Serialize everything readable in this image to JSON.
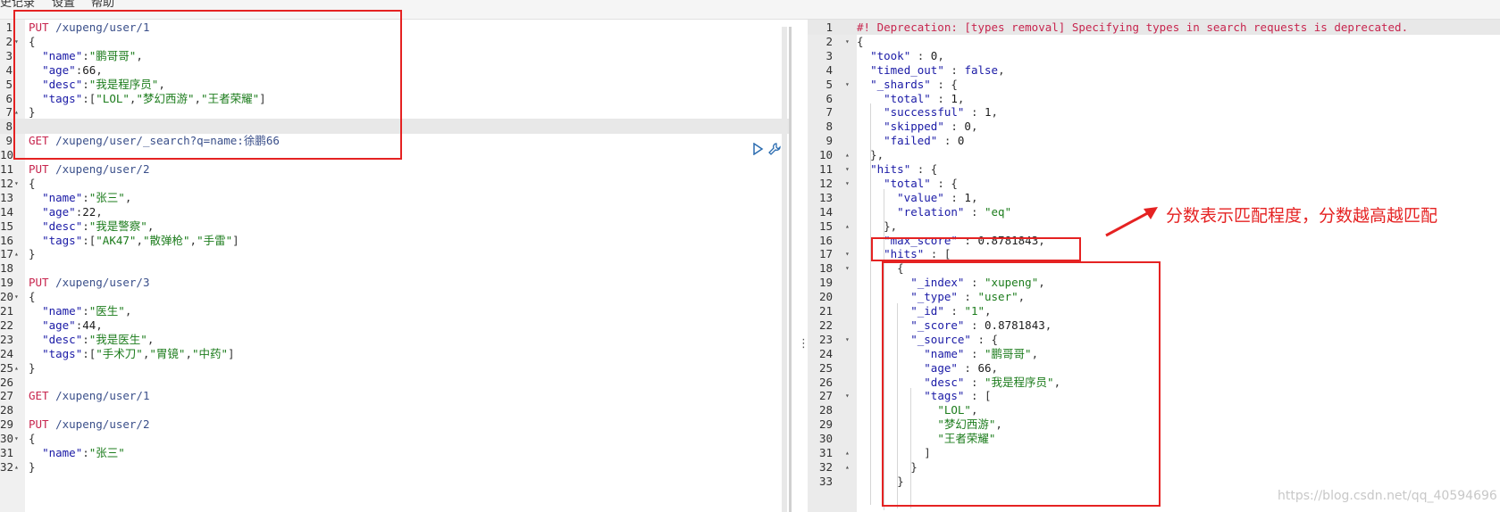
{
  "menu": {
    "history": "史记录",
    "settings": "设置",
    "help": "帮助"
  },
  "request_editor": {
    "lines": [
      [
        {
          "c": "tok-method",
          "t": "PUT "
        },
        {
          "c": "tok-url",
          "t": "/xupeng/user/1"
        }
      ],
      [
        {
          "c": "tok-punc",
          "t": "{"
        }
      ],
      [
        {
          "c": "tok-punc",
          "t": "  "
        },
        {
          "c": "tok-key",
          "t": "\"name\""
        },
        {
          "c": "tok-punc",
          "t": ":"
        },
        {
          "c": "tok-str",
          "t": "\"鹏哥哥\""
        },
        {
          "c": "tok-punc",
          "t": ","
        }
      ],
      [
        {
          "c": "tok-punc",
          "t": "  "
        },
        {
          "c": "tok-key",
          "t": "\"age\""
        },
        {
          "c": "tok-punc",
          "t": ":"
        },
        {
          "c": "tok-num",
          "t": "66"
        },
        {
          "c": "tok-punc",
          "t": ","
        }
      ],
      [
        {
          "c": "tok-punc",
          "t": "  "
        },
        {
          "c": "tok-key",
          "t": "\"desc\""
        },
        {
          "c": "tok-punc",
          "t": ":"
        },
        {
          "c": "tok-str",
          "t": "\"我是程序员\""
        },
        {
          "c": "tok-punc",
          "t": ","
        }
      ],
      [
        {
          "c": "tok-punc",
          "t": "  "
        },
        {
          "c": "tok-key",
          "t": "\"tags\""
        },
        {
          "c": "tok-punc",
          "t": ":["
        },
        {
          "c": "tok-str",
          "t": "\"LOL\""
        },
        {
          "c": "tok-punc",
          "t": ","
        },
        {
          "c": "tok-str",
          "t": "\"梦幻西游\""
        },
        {
          "c": "tok-punc",
          "t": ","
        },
        {
          "c": "tok-str",
          "t": "\"王者荣耀\""
        },
        {
          "c": "tok-punc",
          "t": "]"
        }
      ],
      [
        {
          "c": "tok-punc",
          "t": "}"
        }
      ],
      [],
      [
        {
          "c": "tok-method",
          "t": "GET "
        },
        {
          "c": "tok-url",
          "t": "/xupeng/user/_search?q=name:徐鹏66"
        }
      ],
      [],
      [
        {
          "c": "tok-method",
          "t": "PUT "
        },
        {
          "c": "tok-url",
          "t": "/xupeng/user/2"
        }
      ],
      [
        {
          "c": "tok-punc",
          "t": "{"
        }
      ],
      [
        {
          "c": "tok-punc",
          "t": "  "
        },
        {
          "c": "tok-key",
          "t": "\"name\""
        },
        {
          "c": "tok-punc",
          "t": ":"
        },
        {
          "c": "tok-str",
          "t": "\"张三\""
        },
        {
          "c": "tok-punc",
          "t": ","
        }
      ],
      [
        {
          "c": "tok-punc",
          "t": "  "
        },
        {
          "c": "tok-key",
          "t": "\"age\""
        },
        {
          "c": "tok-punc",
          "t": ":"
        },
        {
          "c": "tok-num",
          "t": "22"
        },
        {
          "c": "tok-punc",
          "t": ","
        }
      ],
      [
        {
          "c": "tok-punc",
          "t": "  "
        },
        {
          "c": "tok-key",
          "t": "\"desc\""
        },
        {
          "c": "tok-punc",
          "t": ":"
        },
        {
          "c": "tok-str",
          "t": "\"我是警察\""
        },
        {
          "c": "tok-punc",
          "t": ","
        }
      ],
      [
        {
          "c": "tok-punc",
          "t": "  "
        },
        {
          "c": "tok-key",
          "t": "\"tags\""
        },
        {
          "c": "tok-punc",
          "t": ":["
        },
        {
          "c": "tok-str",
          "t": "\"AK47\""
        },
        {
          "c": "tok-punc",
          "t": ","
        },
        {
          "c": "tok-str",
          "t": "\"散弹枪\""
        },
        {
          "c": "tok-punc",
          "t": ","
        },
        {
          "c": "tok-str",
          "t": "\"手雷\""
        },
        {
          "c": "tok-punc",
          "t": "]"
        }
      ],
      [
        {
          "c": "tok-punc",
          "t": "}"
        }
      ],
      [],
      [
        {
          "c": "tok-method",
          "t": "PUT "
        },
        {
          "c": "tok-url",
          "t": "/xupeng/user/3"
        }
      ],
      [
        {
          "c": "tok-punc",
          "t": "{"
        }
      ],
      [
        {
          "c": "tok-punc",
          "t": "  "
        },
        {
          "c": "tok-key",
          "t": "\"name\""
        },
        {
          "c": "tok-punc",
          "t": ":"
        },
        {
          "c": "tok-str",
          "t": "\"医生\""
        },
        {
          "c": "tok-punc",
          "t": ","
        }
      ],
      [
        {
          "c": "tok-punc",
          "t": "  "
        },
        {
          "c": "tok-key",
          "t": "\"age\""
        },
        {
          "c": "tok-punc",
          "t": ":"
        },
        {
          "c": "tok-num",
          "t": "44"
        },
        {
          "c": "tok-punc",
          "t": ","
        }
      ],
      [
        {
          "c": "tok-punc",
          "t": "  "
        },
        {
          "c": "tok-key",
          "t": "\"desc\""
        },
        {
          "c": "tok-punc",
          "t": ":"
        },
        {
          "c": "tok-str",
          "t": "\"我是医生\""
        },
        {
          "c": "tok-punc",
          "t": ","
        }
      ],
      [
        {
          "c": "tok-punc",
          "t": "  "
        },
        {
          "c": "tok-key",
          "t": "\"tags\""
        },
        {
          "c": "tok-punc",
          "t": ":["
        },
        {
          "c": "tok-str",
          "t": "\"手术刀\""
        },
        {
          "c": "tok-punc",
          "t": ","
        },
        {
          "c": "tok-str",
          "t": "\"胃镜\""
        },
        {
          "c": "tok-punc",
          "t": ","
        },
        {
          "c": "tok-str",
          "t": "\"中药\""
        },
        {
          "c": "tok-punc",
          "t": "]"
        }
      ],
      [
        {
          "c": "tok-punc",
          "t": "}"
        }
      ],
      [],
      [
        {
          "c": "tok-method",
          "t": "GET "
        },
        {
          "c": "tok-url",
          "t": "/xupeng/user/1"
        }
      ],
      [],
      [
        {
          "c": "tok-method",
          "t": "PUT "
        },
        {
          "c": "tok-url",
          "t": "/xupeng/user/2"
        }
      ],
      [
        {
          "c": "tok-punc",
          "t": "{"
        }
      ],
      [
        {
          "c": "tok-punc",
          "t": "  "
        },
        {
          "c": "tok-key",
          "t": "\"name\""
        },
        {
          "c": "tok-punc",
          "t": ":"
        },
        {
          "c": "tok-str",
          "t": "\"张三\""
        }
      ],
      [
        {
          "c": "tok-punc",
          "t": "}"
        }
      ]
    ],
    "folds": {
      "2": "▾",
      "7": "▴",
      "12": "▾",
      "17": "▴",
      "20": "▾",
      "25": "▴",
      "30": "▾",
      "32": "▴"
    }
  },
  "response_viewer": {
    "lines": [
      [
        {
          "c": "tok-comment",
          "t": "#! Deprecation: [types removal] Specifying types in search requests is deprecated."
        }
      ],
      [
        {
          "c": "tok-punc",
          "t": "{"
        }
      ],
      [
        {
          "c": "tok-punc",
          "t": "  "
        },
        {
          "c": "tok-key",
          "t": "\"took\""
        },
        {
          "c": "tok-punc",
          "t": " : "
        },
        {
          "c": "tok-num",
          "t": "0"
        },
        {
          "c": "tok-punc",
          "t": ","
        }
      ],
      [
        {
          "c": "tok-punc",
          "t": "  "
        },
        {
          "c": "tok-key",
          "t": "\"timed_out\""
        },
        {
          "c": "tok-punc",
          "t": " : "
        },
        {
          "c": "tok-bool",
          "t": "false"
        },
        {
          "c": "tok-punc",
          "t": ","
        }
      ],
      [
        {
          "c": "tok-punc",
          "t": "  "
        },
        {
          "c": "tok-key",
          "t": "\"_shards\""
        },
        {
          "c": "tok-punc",
          "t": " : {"
        }
      ],
      [
        {
          "c": "tok-punc",
          "t": "    "
        },
        {
          "c": "tok-key",
          "t": "\"total\""
        },
        {
          "c": "tok-punc",
          "t": " : "
        },
        {
          "c": "tok-num",
          "t": "1"
        },
        {
          "c": "tok-punc",
          "t": ","
        }
      ],
      [
        {
          "c": "tok-punc",
          "t": "    "
        },
        {
          "c": "tok-key",
          "t": "\"successful\""
        },
        {
          "c": "tok-punc",
          "t": " : "
        },
        {
          "c": "tok-num",
          "t": "1"
        },
        {
          "c": "tok-punc",
          "t": ","
        }
      ],
      [
        {
          "c": "tok-punc",
          "t": "    "
        },
        {
          "c": "tok-key",
          "t": "\"skipped\""
        },
        {
          "c": "tok-punc",
          "t": " : "
        },
        {
          "c": "tok-num",
          "t": "0"
        },
        {
          "c": "tok-punc",
          "t": ","
        }
      ],
      [
        {
          "c": "tok-punc",
          "t": "    "
        },
        {
          "c": "tok-key",
          "t": "\"failed\""
        },
        {
          "c": "tok-punc",
          "t": " : "
        },
        {
          "c": "tok-num",
          "t": "0"
        }
      ],
      [
        {
          "c": "tok-punc",
          "t": "  },"
        }
      ],
      [
        {
          "c": "tok-punc",
          "t": "  "
        },
        {
          "c": "tok-key",
          "t": "\"hits\""
        },
        {
          "c": "tok-punc",
          "t": " : {"
        }
      ],
      [
        {
          "c": "tok-punc",
          "t": "    "
        },
        {
          "c": "tok-key",
          "t": "\"total\""
        },
        {
          "c": "tok-punc",
          "t": " : {"
        }
      ],
      [
        {
          "c": "tok-punc",
          "t": "      "
        },
        {
          "c": "tok-key",
          "t": "\"value\""
        },
        {
          "c": "tok-punc",
          "t": " : "
        },
        {
          "c": "tok-num",
          "t": "1"
        },
        {
          "c": "tok-punc",
          "t": ","
        }
      ],
      [
        {
          "c": "tok-punc",
          "t": "      "
        },
        {
          "c": "tok-key",
          "t": "\"relation\""
        },
        {
          "c": "tok-punc",
          "t": " : "
        },
        {
          "c": "tok-str",
          "t": "\"eq\""
        }
      ],
      [
        {
          "c": "tok-punc",
          "t": "    },"
        }
      ],
      [
        {
          "c": "tok-punc",
          "t": "    "
        },
        {
          "c": "tok-key",
          "t": "\"max_score\""
        },
        {
          "c": "tok-punc",
          "t": " : "
        },
        {
          "c": "tok-num",
          "t": "0.8781843"
        },
        {
          "c": "tok-punc",
          "t": ","
        }
      ],
      [
        {
          "c": "tok-punc",
          "t": "    "
        },
        {
          "c": "tok-key",
          "t": "\"hits\""
        },
        {
          "c": "tok-punc",
          "t": " : ["
        }
      ],
      [
        {
          "c": "tok-punc",
          "t": "      {"
        }
      ],
      [
        {
          "c": "tok-punc",
          "t": "        "
        },
        {
          "c": "tok-key",
          "t": "\"_index\""
        },
        {
          "c": "tok-punc",
          "t": " : "
        },
        {
          "c": "tok-str",
          "t": "\"xupeng\""
        },
        {
          "c": "tok-punc",
          "t": ","
        }
      ],
      [
        {
          "c": "tok-punc",
          "t": "        "
        },
        {
          "c": "tok-key",
          "t": "\"_type\""
        },
        {
          "c": "tok-punc",
          "t": " : "
        },
        {
          "c": "tok-str",
          "t": "\"user\""
        },
        {
          "c": "tok-punc",
          "t": ","
        }
      ],
      [
        {
          "c": "tok-punc",
          "t": "        "
        },
        {
          "c": "tok-key",
          "t": "\"_id\""
        },
        {
          "c": "tok-punc",
          "t": " : "
        },
        {
          "c": "tok-str",
          "t": "\"1\""
        },
        {
          "c": "tok-punc",
          "t": ","
        }
      ],
      [
        {
          "c": "tok-punc",
          "t": "        "
        },
        {
          "c": "tok-key",
          "t": "\"_score\""
        },
        {
          "c": "tok-punc",
          "t": " : "
        },
        {
          "c": "tok-num",
          "t": "0.8781843"
        },
        {
          "c": "tok-punc",
          "t": ","
        }
      ],
      [
        {
          "c": "tok-punc",
          "t": "        "
        },
        {
          "c": "tok-key",
          "t": "\"_source\""
        },
        {
          "c": "tok-punc",
          "t": " : {"
        }
      ],
      [
        {
          "c": "tok-punc",
          "t": "          "
        },
        {
          "c": "tok-key",
          "t": "\"name\""
        },
        {
          "c": "tok-punc",
          "t": " : "
        },
        {
          "c": "tok-str",
          "t": "\"鹏哥哥\""
        },
        {
          "c": "tok-punc",
          "t": ","
        }
      ],
      [
        {
          "c": "tok-punc",
          "t": "          "
        },
        {
          "c": "tok-key",
          "t": "\"age\""
        },
        {
          "c": "tok-punc",
          "t": " : "
        },
        {
          "c": "tok-num",
          "t": "66"
        },
        {
          "c": "tok-punc",
          "t": ","
        }
      ],
      [
        {
          "c": "tok-punc",
          "t": "          "
        },
        {
          "c": "tok-key",
          "t": "\"desc\""
        },
        {
          "c": "tok-punc",
          "t": " : "
        },
        {
          "c": "tok-str",
          "t": "\"我是程序员\""
        },
        {
          "c": "tok-punc",
          "t": ","
        }
      ],
      [
        {
          "c": "tok-punc",
          "t": "          "
        },
        {
          "c": "tok-key",
          "t": "\"tags\""
        },
        {
          "c": "tok-punc",
          "t": " : ["
        }
      ],
      [
        {
          "c": "tok-punc",
          "t": "            "
        },
        {
          "c": "tok-str",
          "t": "\"LOL\""
        },
        {
          "c": "tok-punc",
          "t": ","
        }
      ],
      [
        {
          "c": "tok-punc",
          "t": "            "
        },
        {
          "c": "tok-str",
          "t": "\"梦幻西游\""
        },
        {
          "c": "tok-punc",
          "t": ","
        }
      ],
      [
        {
          "c": "tok-punc",
          "t": "            "
        },
        {
          "c": "tok-str",
          "t": "\"王者荣耀\""
        }
      ],
      [
        {
          "c": "tok-punc",
          "t": "          ]"
        }
      ],
      [
        {
          "c": "tok-punc",
          "t": "        }"
        }
      ],
      [
        {
          "c": "tok-punc",
          "t": "      }"
        }
      ]
    ],
    "folds": {
      "2": "▾",
      "5": "▾",
      "10": "▴",
      "11": "▾",
      "12": "▾",
      "15": "▴",
      "17": "▾",
      "18": "▾",
      "23": "▾",
      "27": "▾",
      "31": "▴",
      "32": "▴"
    }
  },
  "annotation": {
    "text": "分数表示匹配程度，分数越高越匹配"
  },
  "watermark": "https://blog.csdn.net/qq_40594696",
  "colors": {
    "highlight_box": "#e52222",
    "method": "#c7254e",
    "string": "#1c7c1c",
    "key": "#1a1aa6"
  }
}
